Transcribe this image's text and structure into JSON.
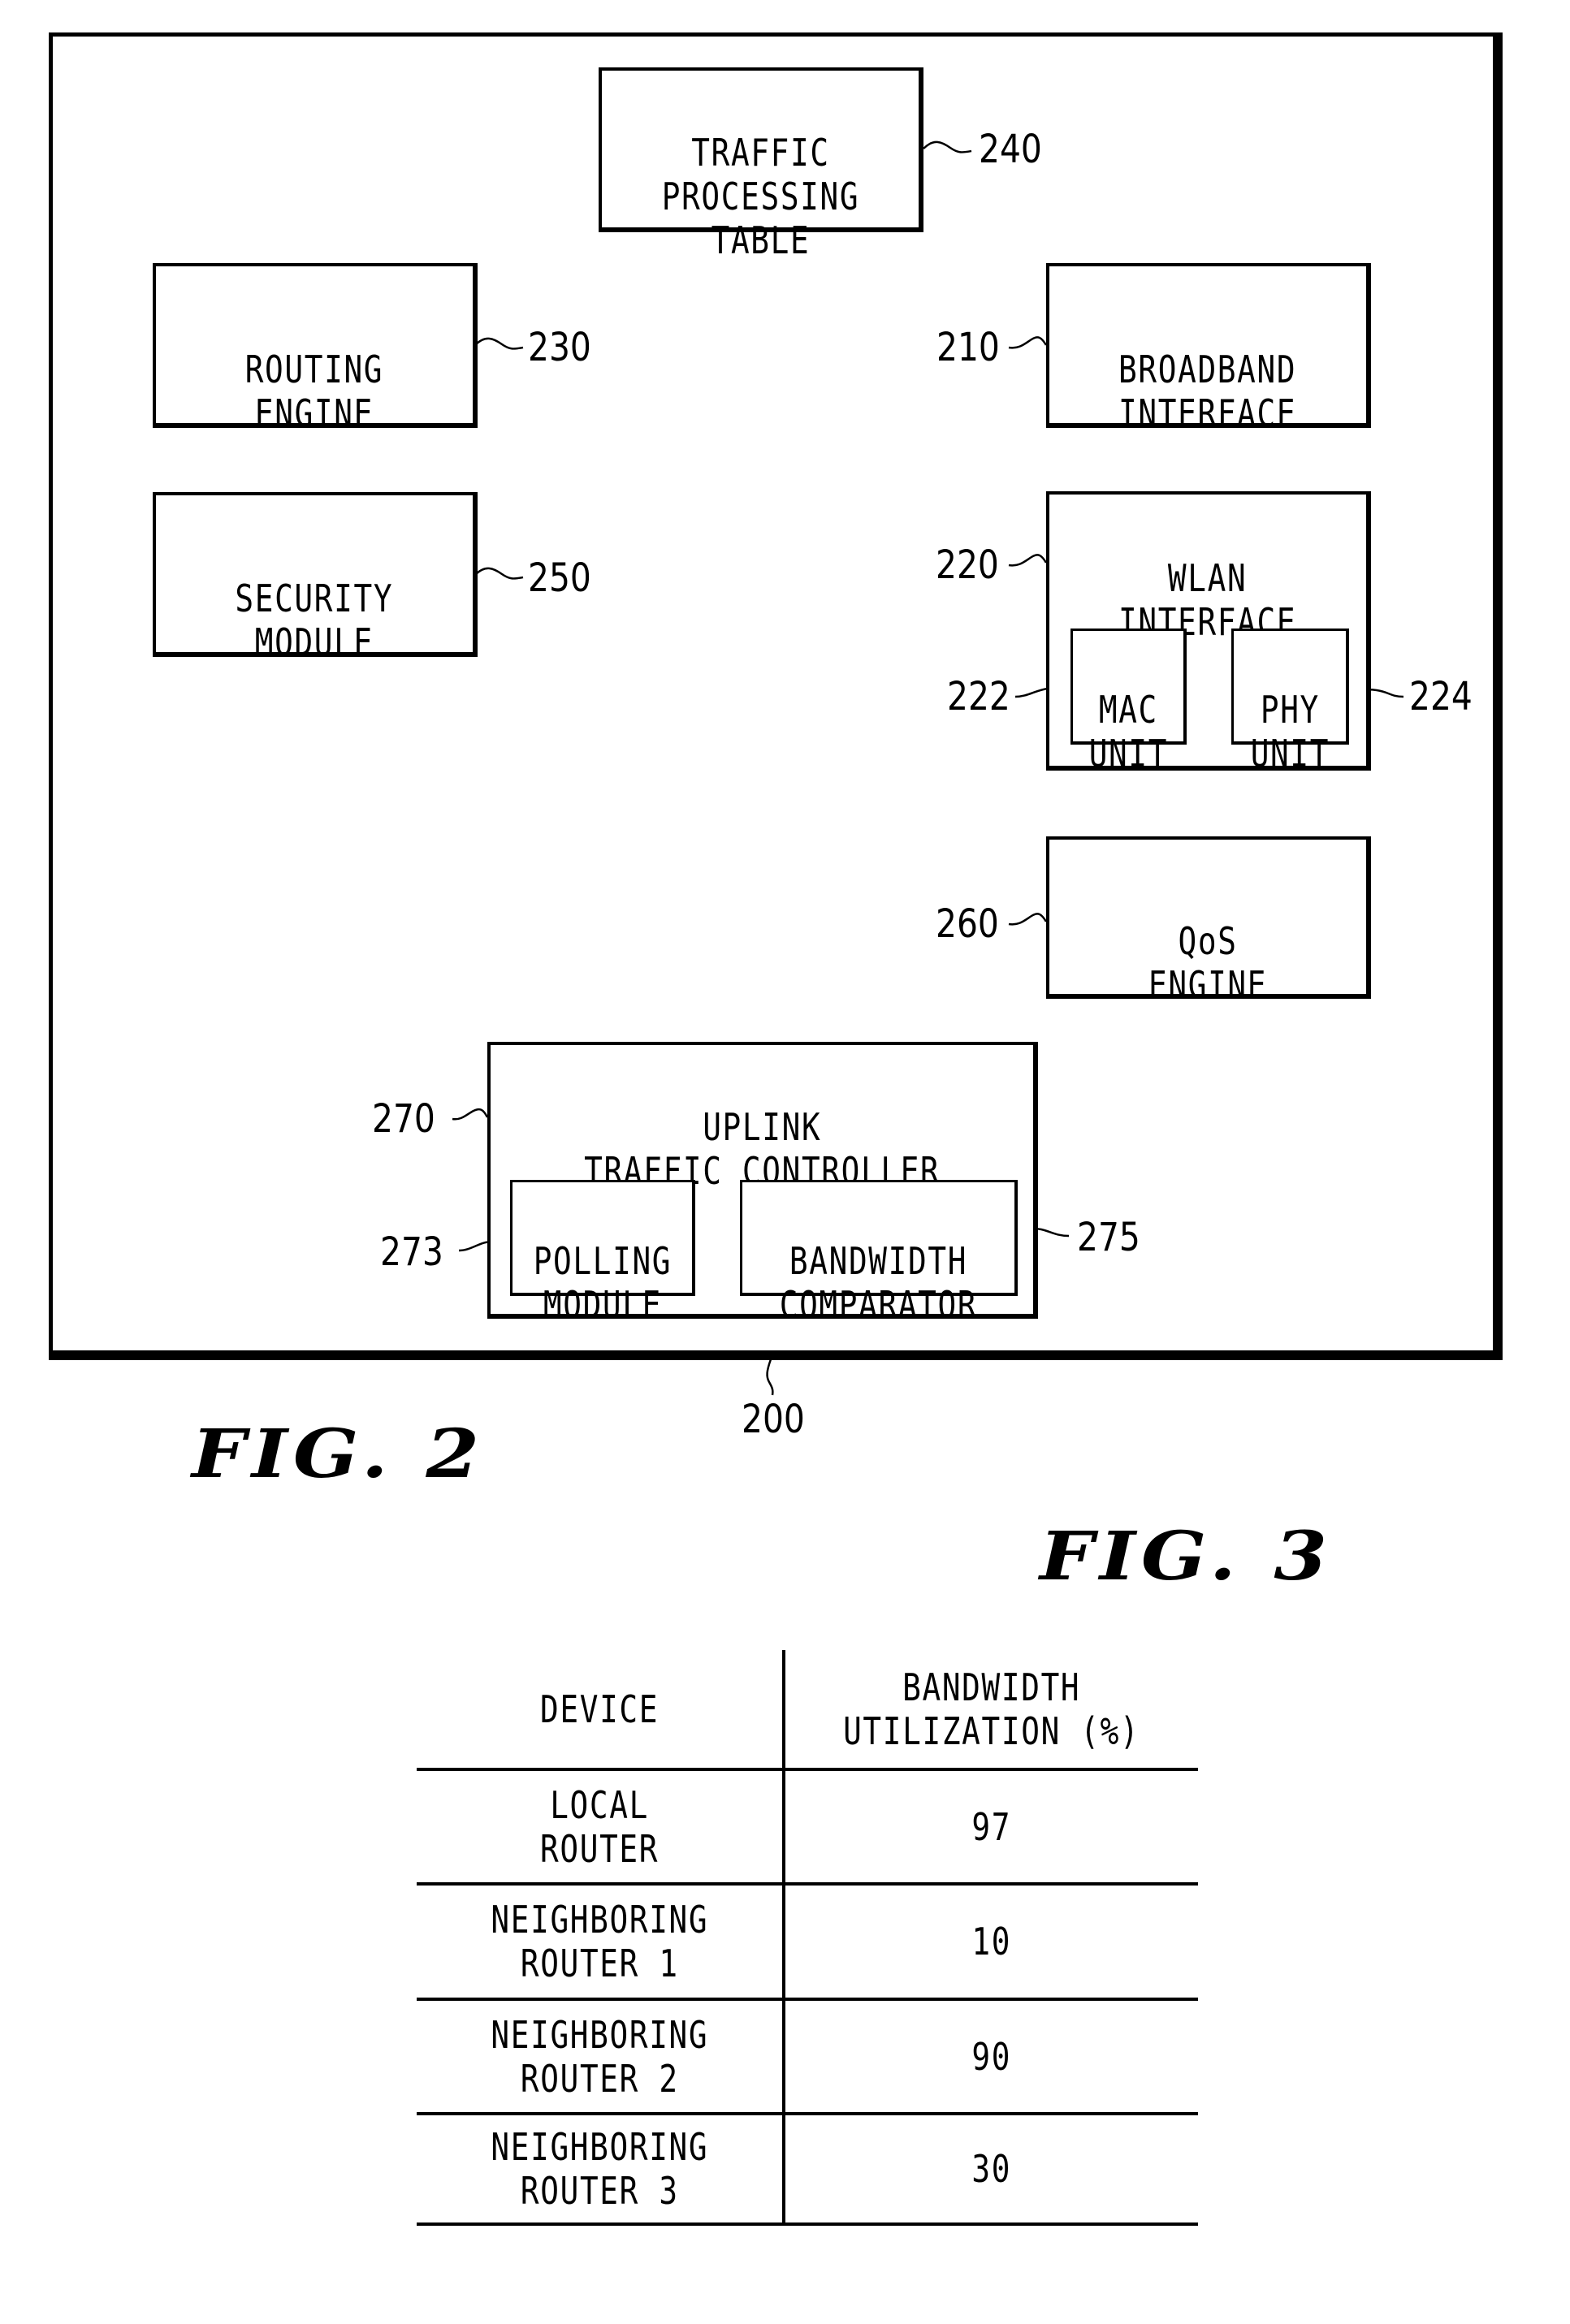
{
  "figure2": {
    "caption": "FIG. 2",
    "device": {
      "ref": "200"
    },
    "blocks": {
      "traffic_processing_table": {
        "label": "TRAFFIC\nPROCESSING\nTABLE",
        "ref": "240"
      },
      "routing_engine": {
        "label": "ROUTING\nENGINE",
        "ref": "230"
      },
      "broadband_interface": {
        "label": "BROADBAND\nINTERFACE",
        "ref": "210"
      },
      "security_module": {
        "label": "SECURITY\nMODULE",
        "ref": "250"
      },
      "wlan_interface": {
        "label": "WLAN\nINTERFACE",
        "ref": "220",
        "mac_unit": {
          "label": "MAC\nUNIT",
          "ref": "222"
        },
        "phy_unit": {
          "label": "PHY\nUNIT",
          "ref": "224"
        }
      },
      "qos_engine": {
        "label": "QoS\nENGINE",
        "ref": "260"
      },
      "uplink_traffic_controller": {
        "label": "UPLINK\nTRAFFIC  CONTROLLER",
        "ref": "270",
        "polling_module": {
          "label": "POLLING\nMODULE",
          "ref": "273"
        },
        "bandwidth_comparator": {
          "label": "BANDWIDTH\nCOMPARATOR",
          "ref": "275"
        }
      }
    }
  },
  "figure3": {
    "caption": "FIG. 3",
    "table": {
      "headers": [
        "DEVICE",
        "BANDWIDTH\nUTILIZATION (%)"
      ],
      "rows": [
        {
          "device": "LOCAL\nROUTER",
          "utilization": "97"
        },
        {
          "device": "NEIGHBORING\nROUTER 1",
          "utilization": "10"
        },
        {
          "device": "NEIGHBORING\nROUTER 2",
          "utilization": "90"
        },
        {
          "device": "NEIGHBORING\nROUTER 3",
          "utilization": "30"
        }
      ]
    }
  }
}
